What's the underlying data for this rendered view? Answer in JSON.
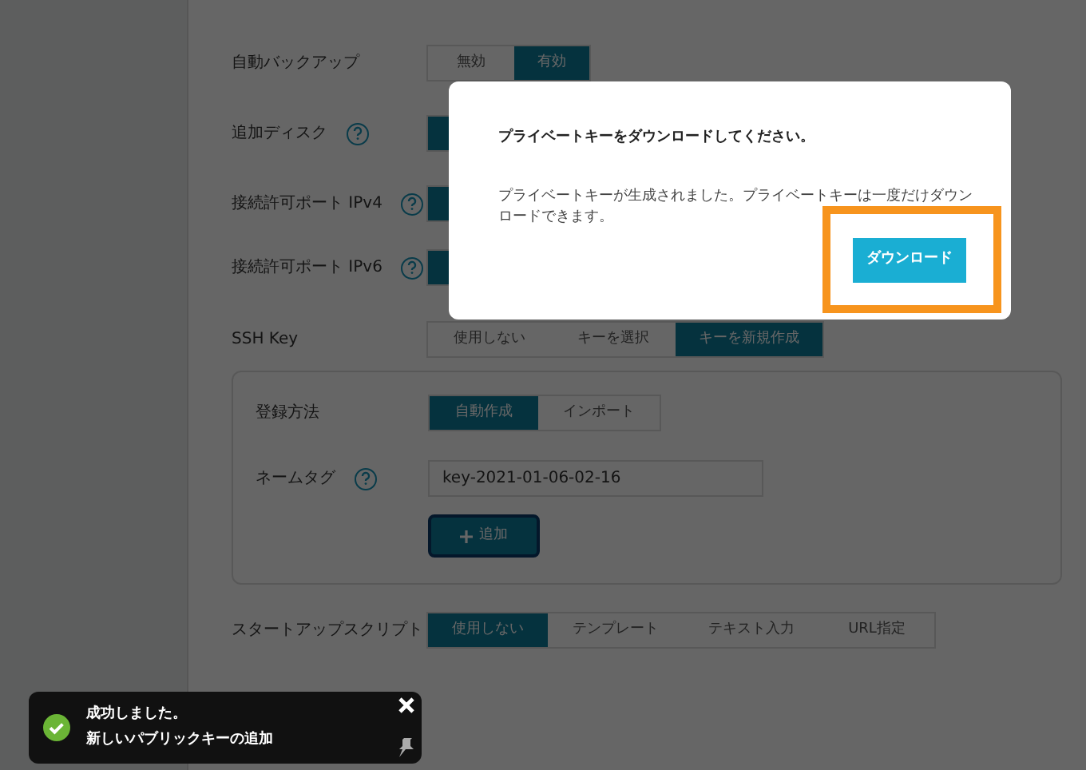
{
  "form": {
    "rows": [
      {
        "label": "自動バックアップ",
        "help": false,
        "options": [
          {
            "label": "無効",
            "selected": false
          },
          {
            "label": "有効",
            "selected": true
          }
        ]
      },
      {
        "label": "追加ディスク",
        "help": true,
        "options": [
          {
            "selected": true
          }
        ]
      },
      {
        "label": "接続許可ポート IPv4",
        "help": true,
        "options": [
          {
            "selected": true
          }
        ]
      },
      {
        "label": "接続許可ポート IPv6",
        "help": true,
        "options": [
          {
            "selected": true
          }
        ]
      },
      {
        "label": "SSH Key",
        "help": false,
        "options": [
          {
            "label": "使用しない",
            "selected": false
          },
          {
            "label": "キーを選択",
            "selected": false
          },
          {
            "label": "キーを新規作成",
            "selected": true
          }
        ]
      }
    ],
    "ssh_panel": {
      "method_label": "登録方法",
      "methods": [
        {
          "label": "自動作成",
          "selected": true
        },
        {
          "label": "インポート",
          "selected": false
        }
      ],
      "name_tag_label": "ネームタグ",
      "name_tag_value": "key-2021-01-06-02-16",
      "add_button": "追加"
    },
    "startup": {
      "label": "スタートアップスクリプト",
      "options": [
        {
          "label": "使用しない",
          "selected": true
        },
        {
          "label": "テンプレート",
          "selected": false
        },
        {
          "label": "テキスト入力",
          "selected": false
        },
        {
          "label": "URL指定",
          "selected": false
        }
      ]
    }
  },
  "dialog": {
    "title": "プライベートキーをダウンロードしてください。",
    "message": "プライベートキーが生成されました。プライベートキーは一度だけダウンロードできます。",
    "button": "ダウンロード",
    "highlighted": true
  },
  "toast": {
    "title": "成功しました。",
    "message": "新しいパブリックキーの追加"
  }
}
